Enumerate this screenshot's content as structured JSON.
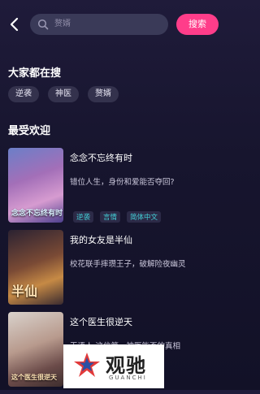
{
  "search": {
    "placeholder": "赘婿",
    "button_label": "搜索"
  },
  "hot_searches": {
    "title": "大家都在搜",
    "items": [
      "逆袭",
      "神医",
      "赘婿"
    ]
  },
  "popular": {
    "title": "最受欢迎",
    "items": [
      {
        "title": "念念不忘终有时",
        "desc": "错位人生，身份和爱能否夺回?",
        "tags": [
          "逆袭",
          "言情",
          "简体中文"
        ],
        "cover_text": "念念不忘终有时"
      },
      {
        "title": "我的女友是半仙",
        "desc": "校花联手摔瓒王子，破解险夜幽灵",
        "tags": [],
        "cover_text": "半仙"
      },
      {
        "title": "这个医生很逆天",
        "desc": "玉语人·这位第一神医能否的真相",
        "tags": [],
        "cover_text": "这个医生很逆天"
      }
    ]
  },
  "watermark": {
    "text": "观驰",
    "sub": "GUANCHI"
  },
  "colors": {
    "accent": "#ff3d8a",
    "tag_text": "#43d1d8",
    "background": "#1a1833"
  }
}
